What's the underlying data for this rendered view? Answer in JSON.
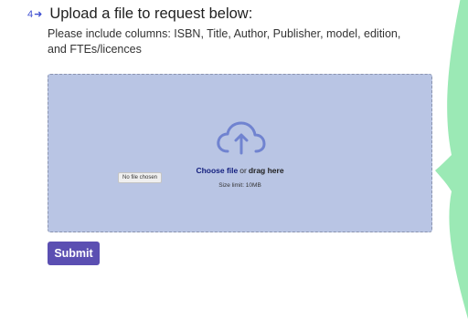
{
  "step": {
    "number": "4",
    "arrow_icon": "right-arrow-icon",
    "title": "Upload a file to request below:"
  },
  "instructions": "Please include columns: ISBN, Title, Author, Publisher, model, edition, and FTEs/licences",
  "dropzone": {
    "icon": "cloud-upload-icon",
    "choose_label": "Choose file",
    "or_label": "or",
    "drag_label": "drag here",
    "size_limit": "Size limit: 10MB",
    "file_status": "No file chosen"
  },
  "submit_label": "Submit",
  "colors": {
    "accent": "#5b4fb2",
    "dropzone_bg": "#b9c5e4",
    "icon": "#7083d0",
    "link": "#14207f",
    "decoration": "#9be9b5"
  }
}
